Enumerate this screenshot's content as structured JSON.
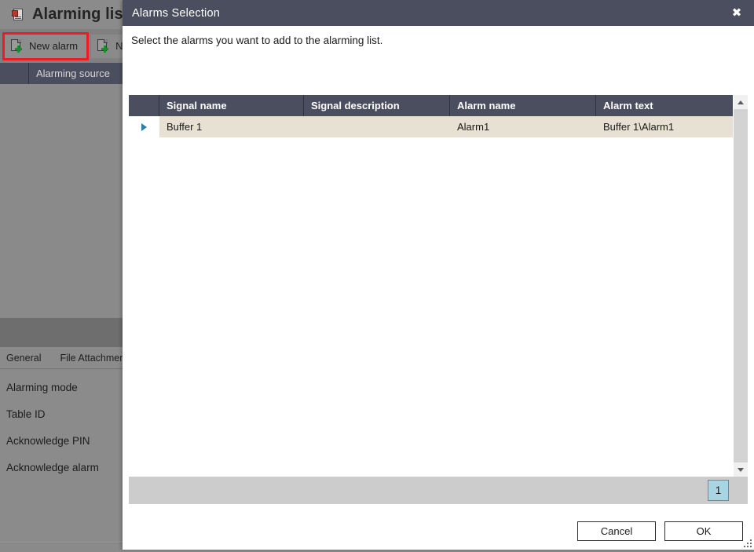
{
  "background_window": {
    "title": "Alarming list",
    "title_icon": "alarming-list-icon",
    "toolbar": [
      {
        "label": "New alarm",
        "icon": "new-document-icon",
        "highlighted": true
      },
      {
        "label": "Ne",
        "icon": "new-document-icon",
        "highlighted": false
      }
    ],
    "grid_header": [
      "Alarming source"
    ],
    "tabs": [
      "General",
      "File Attachment"
    ],
    "properties": [
      "Alarming mode",
      "Table ID",
      "Acknowledge PIN",
      "Acknowledge alarm"
    ]
  },
  "dialog": {
    "title": "Alarms Selection",
    "close_label": "✖",
    "instruction": "Select the alarms you want to add to the alarming list.",
    "table": {
      "columns": [
        "",
        "Signal name",
        "Signal description",
        "Alarm name",
        "Alarm text"
      ],
      "rows": [
        {
          "selected": true,
          "signal_name": "Buffer 1",
          "signal_description": "",
          "alarm_name": "Alarm1",
          "alarm_text": "Buffer 1\\Alarm1"
        }
      ]
    },
    "pager": {
      "current_page": "1"
    },
    "buttons": {
      "cancel": "Cancel",
      "ok": "OK"
    }
  },
  "colors": {
    "dialog_header": "#4b4e5e",
    "selected_row": "#e8e1d3",
    "pager_active": "#a9d4e2",
    "highlight_outline": "#ee1b24",
    "row_indicator_arrow": "#2d7fa8"
  }
}
